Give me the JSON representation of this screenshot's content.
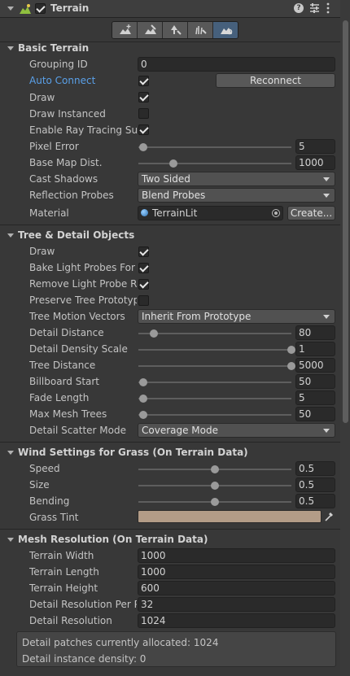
{
  "header": {
    "title": "Terrain"
  },
  "toolbar": {
    "tools": [
      "create-neighbor-icon",
      "paint-terrain-icon",
      "paint-trees-icon",
      "paint-details-icon",
      "terrain-settings-icon"
    ],
    "active": 4
  },
  "basic": {
    "title": "Basic Terrain",
    "grouping_id_label": "Grouping ID",
    "grouping_id": "0",
    "auto_connect_label": "Auto Connect",
    "reconnect": "Reconnect",
    "draw_label": "Draw",
    "draw_instanced_label": "Draw Instanced",
    "ray_tracing_label": "Enable Ray Tracing Sup",
    "pixel_error_label": "Pixel Error",
    "pixel_error": "5",
    "pixel_error_frac": 0.03,
    "base_map_label": "Base Map Dist.",
    "base_map": "1000",
    "base_map_frac": 0.23,
    "cast_shadows_label": "Cast Shadows",
    "cast_shadows": "Two Sided",
    "reflection_label": "Reflection Probes",
    "reflection": "Blend Probes",
    "material_label": "Material",
    "material": "TerrainLit",
    "create": "Create..."
  },
  "tree": {
    "title": "Tree & Detail Objects",
    "draw_label": "Draw",
    "bake_label": "Bake Light Probes For T",
    "remove_label": "Remove Light Probe Rin",
    "preserve_label": "Preserve Tree Prototyp",
    "motion_label": "Tree Motion Vectors",
    "motion": "Inherit From Prototype",
    "detail_distance_label": "Detail Distance",
    "detail_distance": "80",
    "detail_distance_frac": 0.1,
    "detail_density_label": "Detail Density Scale",
    "detail_density": "1",
    "detail_density_frac": 1.0,
    "tree_distance_label": "Tree Distance",
    "tree_distance": "5000",
    "tree_distance_frac": 1.0,
    "billboard_label": "Billboard Start",
    "billboard": "50",
    "billboard_frac": 0.03,
    "fade_label": "Fade Length",
    "fade": "5",
    "fade_frac": 0.03,
    "max_mesh_label": "Max Mesh Trees",
    "max_mesh": "50",
    "max_mesh_frac": 0.03,
    "scatter_label": "Detail Scatter Mode",
    "scatter": "Coverage Mode"
  },
  "wind": {
    "title": "Wind Settings for Grass (On Terrain Data)",
    "speed_label": "Speed",
    "speed": "0.5",
    "speed_frac": 0.5,
    "size_label": "Size",
    "size": "0.5",
    "size_frac": 0.5,
    "bending_label": "Bending",
    "bending": "0.5",
    "bending_frac": 0.5,
    "tint_label": "Grass Tint",
    "tint_color": "#b39c87"
  },
  "mesh": {
    "title": "Mesh Resolution (On Terrain Data)",
    "width_label": "Terrain Width",
    "width": "1000",
    "length_label": "Terrain Length",
    "length": "1000",
    "height_label": "Terrain Height",
    "height": "600",
    "detail_res_patch_label": "Detail Resolution Per Pa",
    "detail_res_patch": "32",
    "detail_res_label": "Detail Resolution",
    "detail_res": "1024",
    "info1": "Detail patches currently allocated: 1024",
    "info2": "Detail instance density: 0"
  }
}
